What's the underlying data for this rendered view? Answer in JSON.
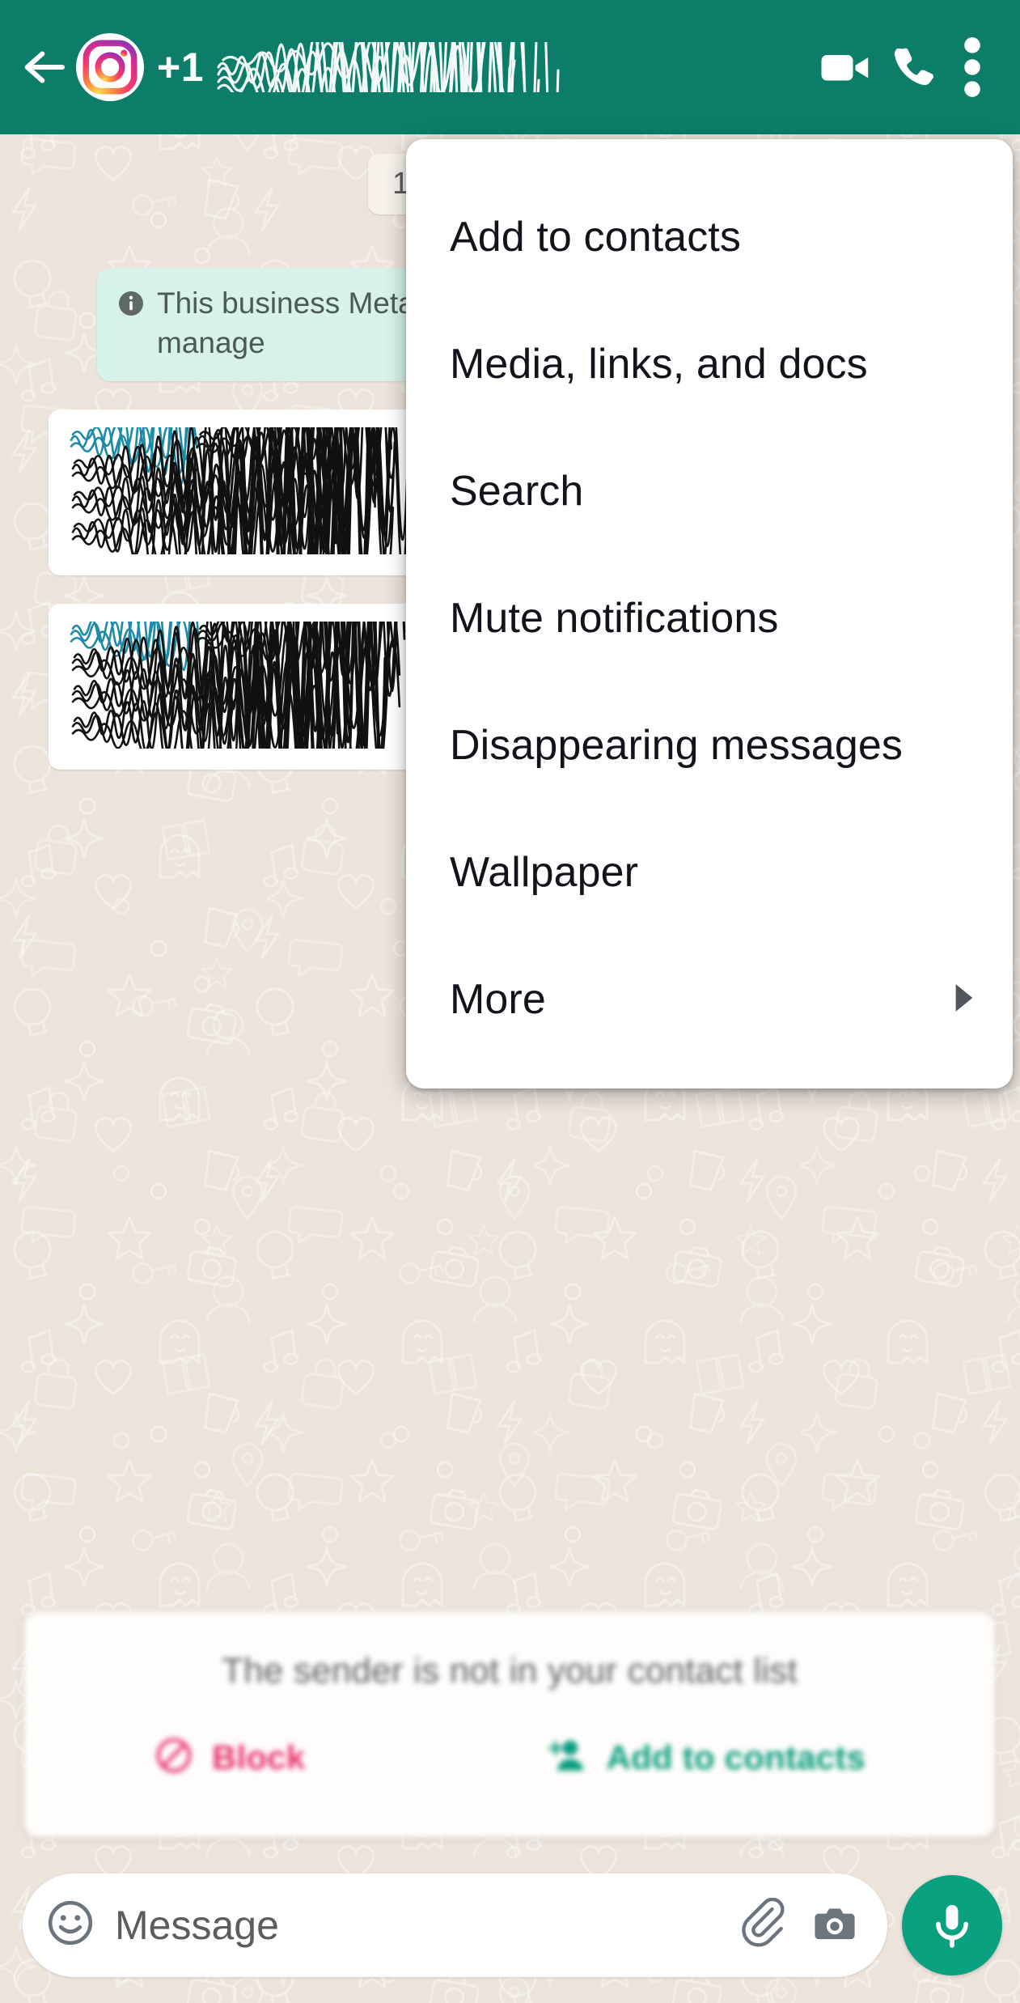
{
  "app": "WhatsApp",
  "header": {
    "back_icon": "back-arrow-icon",
    "avatar_icon": "instagram-avatar-icon",
    "country_code": "+1",
    "contact_name_redacted": true,
    "video_call_icon": "video-call-icon",
    "voice_call_icon": "voice-call-icon",
    "overflow_icon": "three-dots-vertical-icon",
    "bg_color": "#0b7d68"
  },
  "chat": {
    "date_pill": "1",
    "business_banner": {
      "icon": "info-icon",
      "text": "This business  Meta to manage",
      "bg_color": "#d6f2ea"
    },
    "messages": [
      {
        "redacted": true,
        "link_line_color": "#1c8ba8",
        "lines": 4
      },
      {
        "redacted": true,
        "link_line_color": "#1c8ba8",
        "lines": 4
      }
    ],
    "wallpaper_color": "#ece3db"
  },
  "overflow_menu": {
    "visible": true,
    "items": [
      {
        "label": "Add to contacts",
        "has_submenu": false
      },
      {
        "label": "Media, links, and docs",
        "has_submenu": false
      },
      {
        "label": "Search",
        "has_submenu": false
      },
      {
        "label": "Mute notifications",
        "has_submenu": false
      },
      {
        "label": "Disappearing messages",
        "has_submenu": false
      },
      {
        "label": "Wallpaper",
        "has_submenu": false
      },
      {
        "label": "More",
        "has_submenu": true
      }
    ]
  },
  "sender_card": {
    "text": "The sender is not in your contact list",
    "block_label": "Block",
    "block_color": "#e6316b",
    "add_label": "Add to contacts",
    "add_color": "#0a9b7d"
  },
  "input_bar": {
    "placeholder": "Message",
    "value": "",
    "emoji_icon": "emoji-smiley-icon",
    "attach_icon": "paperclip-icon",
    "camera_icon": "camera-icon",
    "mic_icon": "microphone-icon",
    "mic_bg_color": "#0aa181"
  }
}
